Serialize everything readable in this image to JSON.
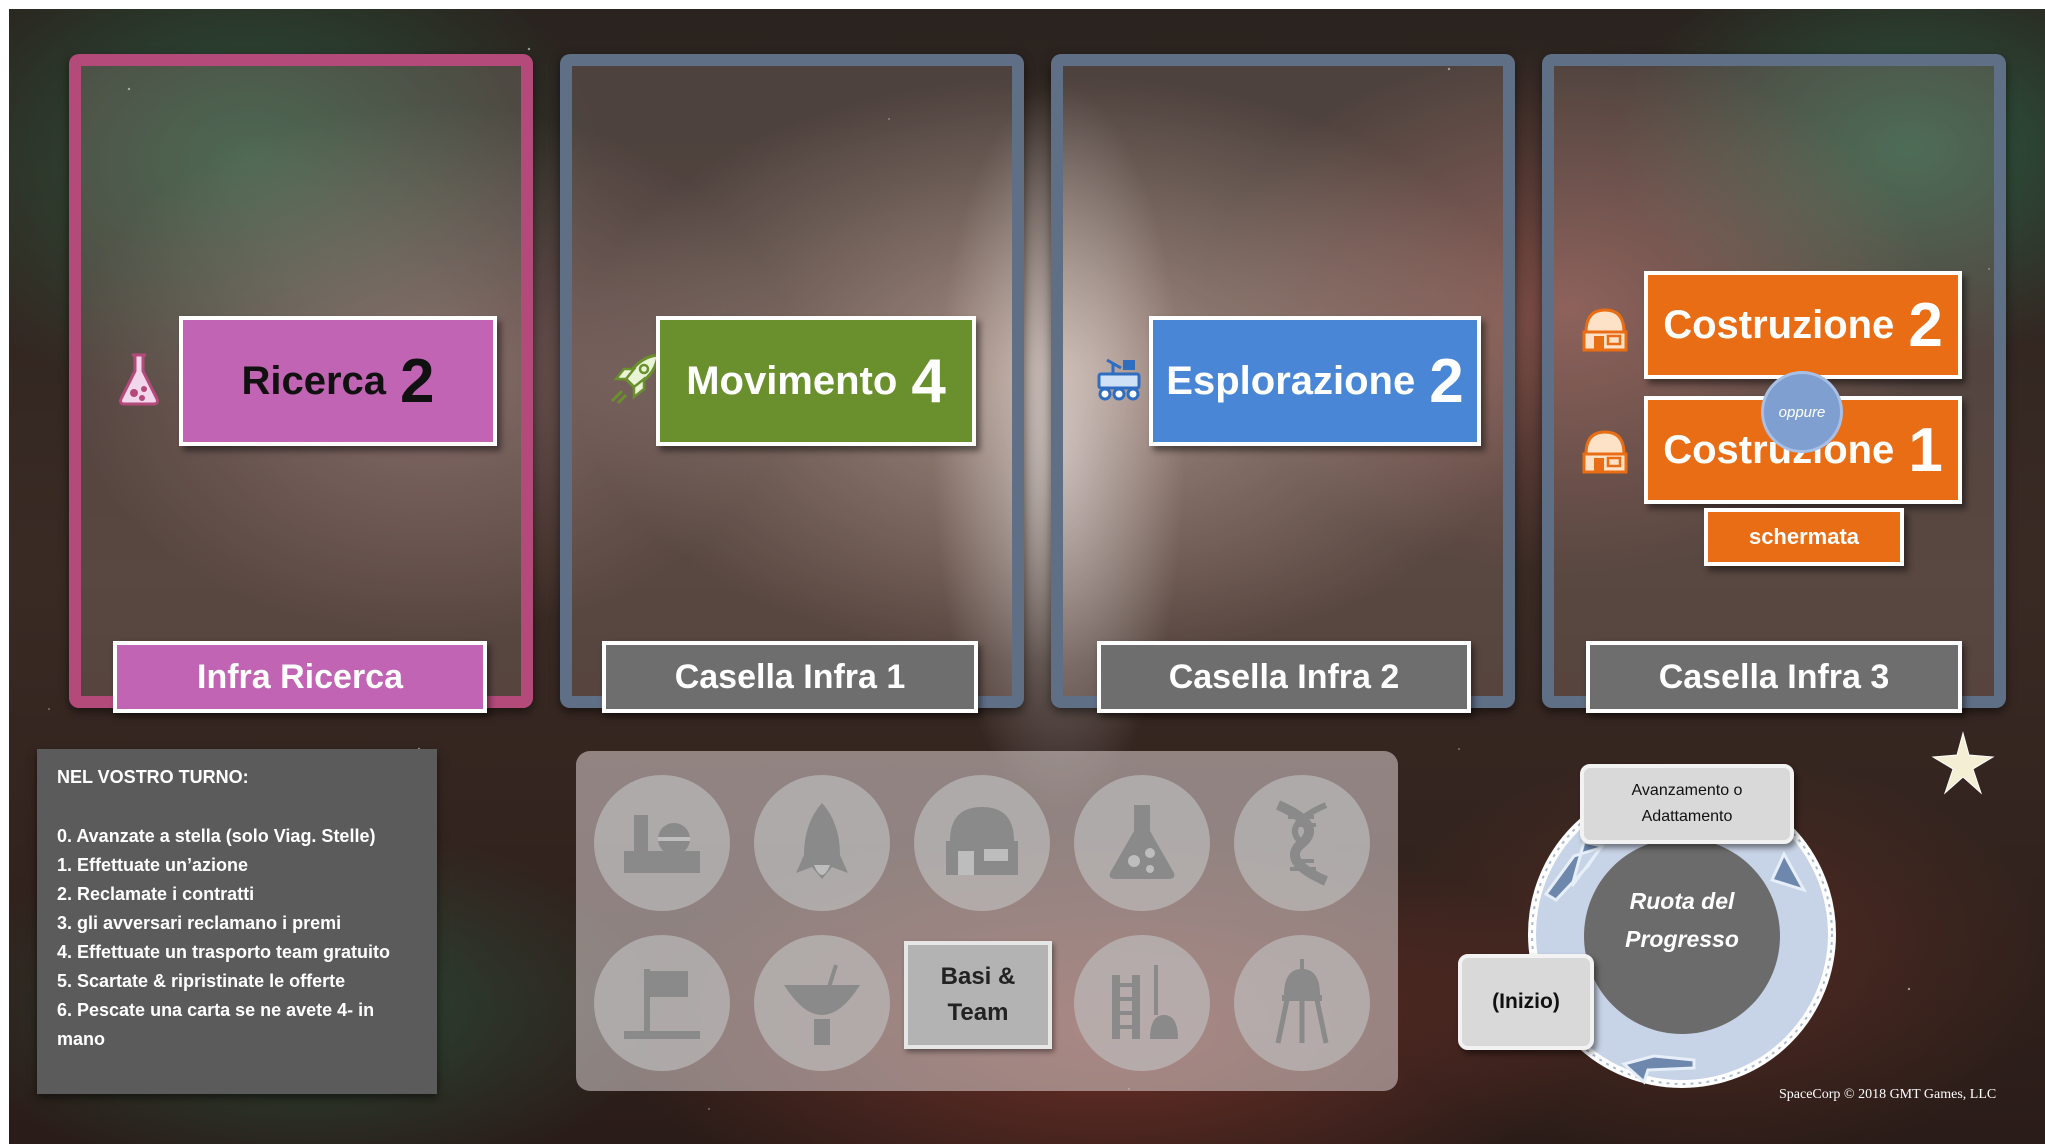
{
  "cards": [
    {
      "action_word": "Ricerca",
      "action_num": "2",
      "infra_label": "Infra Ricerca",
      "icon": "flask-icon"
    },
    {
      "action_word": "Movimento",
      "action_num": "4",
      "infra_label": "Casella Infra 1",
      "icon": "rocket-icon"
    },
    {
      "action_word": "Esplorazione",
      "action_num": "2",
      "infra_label": "Casella Infra 2",
      "icon": "rover-icon"
    },
    {
      "build_top_word": "Costruzione",
      "build_top_num": "2",
      "or_label": "oppure",
      "build_bottom_word": "Costruzione",
      "build_bottom_num": "1",
      "shield_label": "schermata",
      "infra_label": "Casella Infra 3",
      "icon": "base-dome-icon"
    }
  ],
  "turn": {
    "title": "NEL VOSTRO TURNO:",
    "steps": [
      "0. Avanzate a stella (solo Viag. Stelle)",
      "1. Effettuate un’azione",
      "2. Reclamate i contratti",
      "3. gli avversari reclamano i premi",
      "4. Effettuate un trasporto team gratuito",
      "5. Scartate & ripristinate le offerte",
      "6. Pescate una carta se ne avete 4- in",
      "mano"
    ]
  },
  "bases": {
    "line1": "Basi &",
    "line2": "Team"
  },
  "wheel": {
    "center_line1": "Ruota del",
    "center_line2": "Progresso",
    "top_line1": "Avanzamento o",
    "top_line2": "Adattamento",
    "start_label": "(Inizio)"
  },
  "copyright": "SpaceCorp © 2018 GMT Games, LLC",
  "colors": {
    "research": "#c164b3",
    "movement": "#6a8f2d",
    "exploration": "#4a86d6",
    "construction": "#e86d14",
    "infra_gray": "#6e6e6e"
  }
}
